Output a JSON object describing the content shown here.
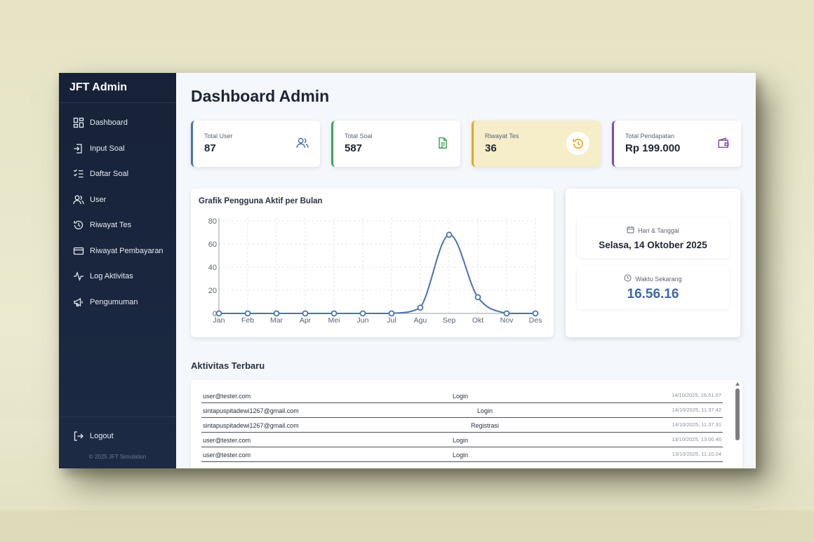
{
  "sidebar": {
    "brand": "JFT Admin",
    "items": [
      {
        "label": "Dashboard",
        "icon": "grid-icon"
      },
      {
        "label": "Input Soal",
        "icon": "file-import-icon"
      },
      {
        "label": "Daftar Soal",
        "icon": "list-check-icon"
      },
      {
        "label": "User",
        "icon": "users-icon"
      },
      {
        "label": "Riwayat Tes",
        "icon": "history-icon"
      },
      {
        "label": "Riwayat Pembayaran",
        "icon": "credit-card-icon"
      },
      {
        "label": "Log Aktivitas",
        "icon": "activity-icon"
      },
      {
        "label": "Pengumuman",
        "icon": "megaphone-icon"
      }
    ],
    "logout": "Logout",
    "copyright": "© 2025 JFT Simulation"
  },
  "header": {
    "title": "Dashboard Admin"
  },
  "stats": [
    {
      "label": "Total User",
      "value": "87",
      "icon": "users-icon",
      "color": "#4a72b3"
    },
    {
      "label": "Total Soal",
      "value": "587",
      "icon": "document-icon",
      "color": "#3aa655"
    },
    {
      "label": "Riwayat Tes",
      "value": "36",
      "icon": "history-icon",
      "color": "#e0a91e"
    },
    {
      "label": "Total Pendapatan",
      "value": "Rp 199.000",
      "icon": "wallet-icon",
      "color": "#7b4fa6"
    }
  ],
  "chart_card": {
    "title": "Grafik Pengguna Aktif per Bulan"
  },
  "chart_data": {
    "type": "line",
    "title": "Grafik Pengguna Aktif per Bulan",
    "categories": [
      "Jan",
      "Feb",
      "Mar",
      "Apr",
      "Mei",
      "Jun",
      "Jul",
      "Agu",
      "Sep",
      "Okt",
      "Nov",
      "Des"
    ],
    "series": [
      {
        "values": [
          0,
          0,
          0,
          0,
          0,
          0,
          0,
          5,
          68,
          14,
          0,
          0
        ],
        "color": "#4a72b3"
      }
    ],
    "y_ticks": [
      0,
      20,
      40,
      60,
      80
    ],
    "ylim": [
      0,
      80
    ],
    "grid": true,
    "smooth": true
  },
  "info": {
    "date_label": "Hari & Tanggal",
    "date_value": "Selasa, 14 Oktober 2025",
    "time_label": "Waktu Sekarang",
    "time_value": "16.56.16"
  },
  "activity": {
    "title": "Aktivitas Terbaru",
    "rows": [
      {
        "email": "user@tester.com",
        "action": "Login",
        "time": "14/10/2025, 16.51.07"
      },
      {
        "email": "sintapuspitadewi1267@gmail.com",
        "action": "Login",
        "time": "14/10/2025, 11.37.42"
      },
      {
        "email": "sintapuspitadewi1267@gmail.com",
        "action": "Registrasi",
        "time": "14/10/2025, 11.37.31"
      },
      {
        "email": "user@tester.com",
        "action": "Login",
        "time": "13/10/2025, 13.00.46"
      },
      {
        "email": "user@tester.com",
        "action": "Login",
        "time": "13/10/2025, 11.10.04"
      }
    ]
  }
}
